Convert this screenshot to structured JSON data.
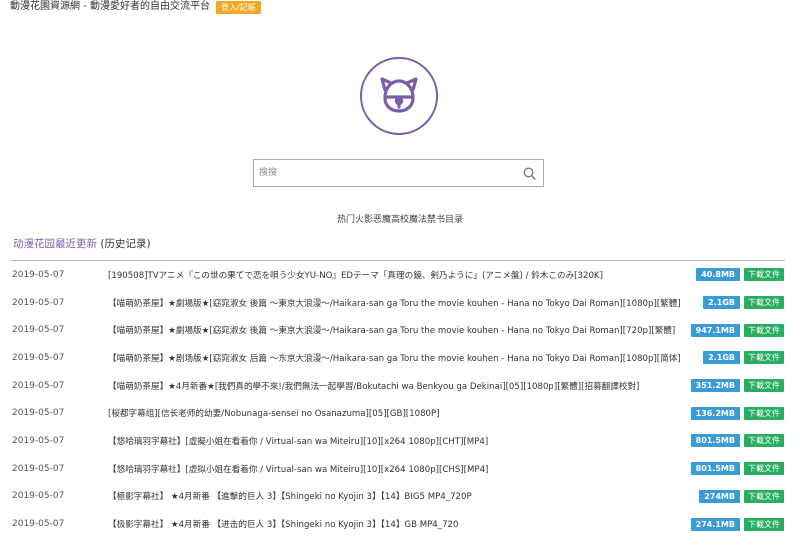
{
  "header": {
    "site_title": "動漫花園資源網 - 動漫愛好者的自由交流平台",
    "login_label": "登入/記帳"
  },
  "logo": {
    "icon": "bell-cat-logo-icon",
    "color": "#7b5ea8"
  },
  "search": {
    "placeholder": "搜搜",
    "value": "",
    "icon": "search-icon"
  },
  "hot_keywords": "热门火影恶魔高校魔法禁书目录",
  "section": {
    "title": "动漫花园最近更新",
    "history_label": "(历史记录)"
  },
  "colors": {
    "accent": "#7b5ea8",
    "size_badge": "#3a9bd9",
    "download": "#27ae60",
    "login": "#f5a623"
  },
  "download_label": "下載文件",
  "rows": [
    {
      "date": "2019-05-07",
      "title": "[190508]TVアニメ『この世の果てで恋を唄う少女YU-NO』EDテーマ「真理の鏡、剣乃ように」(アニメ盤) / 鈴木このみ[320K]",
      "size": "40.8MB"
    },
    {
      "date": "2019-05-07",
      "title": "【喵萌奶茶屋】★劇場版★[窈窕淑女 後篇 ～東京大浪漫～/Haikara-san ga Toru the movie kouhen - Hana no Tokyo Dai Roman][1080p][繁體]",
      "size": "2.1GB"
    },
    {
      "date": "2019-05-07",
      "title": "【喵萌奶茶屋】★劇場版★[窈窕淑女 後篇 ～東京大浪漫～/Haikara-san ga Toru the movie kouhen - Hana no Tokyo Dai Roman][720p][繁體]",
      "size": "947.1MB"
    },
    {
      "date": "2019-05-07",
      "title": "【喵萌奶茶屋】★剧场版★[窈窕淑女 后篇 ～东京大浪漫～/Haikara-san ga Toru the movie kouhen - Hana no Tokyo Dai Roman][1080p][简体]",
      "size": "2.1GB"
    },
    {
      "date": "2019-05-07",
      "title": "【喵萌奶茶屋】★4月新番★[我們真的學不來!/我們無法一起學習/Bokutachi wa Benkyou ga Dekinai][05][1080p][繁體][招募翻譯校對]",
      "size": "351.2MB"
    },
    {
      "date": "2019-05-07",
      "title": "[桜都字幕组][信长老师的幼妻/Nobunaga-sensei no Osanazuma][05][GB][1080P]",
      "size": "136.2MB"
    },
    {
      "date": "2019-05-07",
      "title": "【悠哈璃羽字幕社】[虛擬小姐在看着你 / Virtual-san wa Miteiru][10][x264 1080p][CHT][MP4]",
      "size": "801.5MB"
    },
    {
      "date": "2019-05-07",
      "title": "【悠哈璃羽字幕社】[虚拟小姐在看着你 / Virtual-san wa Miteiru][10][x264 1080p][CHS][MP4]",
      "size": "801.5MB"
    },
    {
      "date": "2019-05-07",
      "title": "【極影字幕社】 ★4月新番 【進擊的巨人 3】【Shingeki no Kyojin 3】【14】BIG5 MP4_720P",
      "size": "274MB"
    },
    {
      "date": "2019-05-07",
      "title": "【极影字幕社】 ★4月新番 【进击的巨人 3】【Shingeki no Kyojin 3】【14】GB MP4_720",
      "size": "274.1MB"
    }
  ]
}
